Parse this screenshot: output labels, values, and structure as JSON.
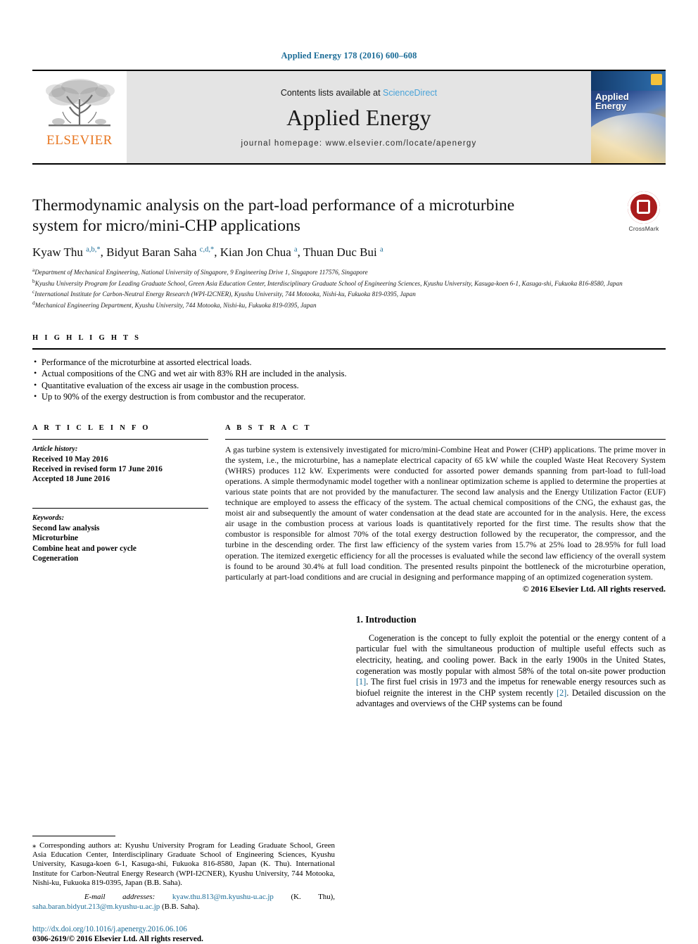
{
  "header": {
    "running_head": "Applied Energy 178 (2016) 600–608"
  },
  "masthead": {
    "publisher_name": "ELSEVIER",
    "contents_prefix": "Contents lists available at ",
    "sciencedirect": "ScienceDirect",
    "journal_title": "Applied Energy",
    "homepage": "journal homepage: www.elsevier.com/locate/apenergy",
    "cover_title_line1": "Applied",
    "cover_title_line2": "Energy"
  },
  "article": {
    "title": "Thermodynamic analysis on the part-load performance of a microturbine system for micro/mini-CHP applications",
    "crossmark_label": "CrossMark",
    "authors_html": "Kyaw Thu <sup>a,b,</sup><sup>*</sup>, Bidyut Baran Saha <sup>c,d,</sup><sup>*</sup>, Kian Jon Chua <sup>a</sup>, Thuan Duc Bui <sup>a</sup>",
    "affiliations": [
      {
        "marker": "a",
        "text": "Department of Mechanical Engineering, National University of Singapore, 9 Engineering Drive 1, Singapore 117576, Singapore"
      },
      {
        "marker": "b",
        "text": "Kyushu University Program for Leading Graduate School, Green Asia Education Center, Interdisciplinary Graduate School of Engineering Sciences, Kyushu University, Kasuga-koen 6-1, Kasuga-shi, Fukuoka 816-8580, Japan"
      },
      {
        "marker": "c",
        "text": "International Institute for Carbon-Neutral Energy Research (WPI-I2CNER), Kyushu University, 744 Motooka, Nishi-ku, Fukuoka 819-0395, Japan"
      },
      {
        "marker": "d",
        "text": "Mechanical Engineering Department, Kyushu University, 744 Motooka, Nishi-ku, Fukuoka 819-0395, Japan"
      }
    ]
  },
  "highlights": {
    "heading": "H I G H L I G H T S",
    "items": [
      "Performance of the microturbine at assorted electrical loads.",
      "Actual compositions of the CNG and wet air with 83% RH are included in the analysis.",
      "Quantitative evaluation of the excess air usage in the combustion process.",
      "Up to 90% of the exergy destruction is from combustor and the recuperator."
    ]
  },
  "article_info": {
    "heading": "A R T I C L E   I N F O",
    "history_label": "Article history:",
    "history": [
      "Received 10 May 2016",
      "Received in revised form 17 June 2016",
      "Accepted 18 June 2016"
    ],
    "keywords_label": "Keywords:",
    "keywords": [
      "Second law analysis",
      "Microturbine",
      "Combine heat and power cycle",
      "Cogeneration"
    ]
  },
  "abstract": {
    "heading": "A B S T R A C T",
    "text": "A gas turbine system is extensively investigated for micro/mini-Combine Heat and Power (CHP) applications. The prime mover in the system, i.e., the microturbine, has a nameplate electrical capacity of 65 kW while the coupled Waste Heat Recovery System (WHRS) produces 112 kW. Experiments were conducted for assorted power demands spanning from part-load to full-load operations. A simple thermodynamic model together with a nonlinear optimization scheme is applied to determine the properties at various state points that are not provided by the manufacturer. The second law analysis and the Energy Utilization Factor (EUF) technique are employed to assess the efficacy of the system. The actual chemical compositions of the CNG, the exhaust gas, the moist air and subsequently the amount of water condensation at the dead state are accounted for in the analysis. Here, the excess air usage in the combustion process at various loads is quantitatively reported for the first time. The results show that the combustor is responsible for almost 70% of the total exergy destruction followed by the recuperator, the compressor, and the turbine in the descending order. The first law efficiency of the system varies from 15.7% at 25% load to 28.95% for full load operation. The itemized exergetic efficiency for all the processes is evaluated while the second law efficiency of the overall system is found to be around 30.4% at full load condition. The presented results pinpoint the bottleneck of the microturbine operation, particularly at part-load conditions and are crucial in designing and performance mapping of an optimized cogeneration system.",
    "copyright": "© 2016 Elsevier Ltd. All rights reserved."
  },
  "introduction": {
    "heading": "1. Introduction",
    "paragraph_1a": "Cogeneration is the concept to fully exploit the potential or the energy content of a particular fuel with the simultaneous production of multiple useful effects such as electricity, heating, and cooling power. Back in the early 1900s in the United States, cogeneration was mostly popular with almost 58% of the total on-site power production ",
    "ref_1": "[1]",
    "paragraph_1b": ". The first fuel crisis in 1973 and the impetus for renewable energy resources such as biofuel reignite the interest in the CHP system recently ",
    "ref_2": "[2]",
    "paragraph_1c": ". Detailed discussion on the advantages and overviews of the CHP systems can be found"
  },
  "footnotes": {
    "corresponding_marker": "⁎",
    "corresponding_text": " Corresponding authors at: Kyushu University Program for Leading Graduate School, Green Asia Education Center, Interdisciplinary Graduate School of Engineering Sciences, Kyushu University, Kasuga-koen 6-1, Kasuga-shi, Fukuoka 816-8580, Japan (K. Thu). International Institute for Carbon-Neutral Energy Research (WPI-I2CNER), Kyushu University, 744 Motooka, Nishi-ku, Fukuoka 819-0395, Japan (B.B. Saha).",
    "email_label": "E-mail addresses:",
    "email_1": "kyaw.thu.813@m.kyushu-u.ac.jp",
    "email_1_owner": " (K. Thu), ",
    "email_2": "saha.baran.bidyut.213@m.kyushu-u.ac.jp",
    "email_2_owner": " (B.B. Saha).",
    "doi": "http://dx.doi.org/10.1016/j.apenergy.2016.06.106",
    "issn_line": "0306-2619/© 2016 Elsevier Ltd. All rights reserved."
  }
}
